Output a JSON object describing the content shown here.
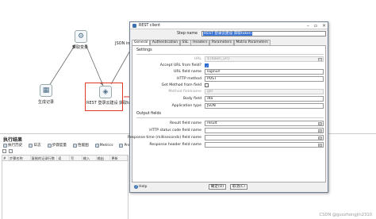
{
  "canvas": {
    "steps": [
      {
        "id": "get-var",
        "label": "获取变量",
        "glyph": "⚙"
      },
      {
        "id": "gen-record",
        "label": "生成记录",
        "glyph": "▦"
      },
      {
        "id": "rest",
        "label": "REST 登录云建设  获取token",
        "glyph": "◈"
      },
      {
        "id": "json-input",
        "label": "JSON inp",
        "glyph": "{}"
      }
    ]
  },
  "exec": {
    "title": "执行结果",
    "tabs": [
      {
        "label": "执行历史",
        "icon": "history-icon"
      },
      {
        "label": "日志",
        "icon": "log-icon"
      },
      {
        "label": "步骤度量",
        "icon": "metrics-icon"
      },
      {
        "label": "性能图",
        "icon": "chart-icon"
      },
      {
        "label": "Metrics",
        "icon": "metrics-icon"
      },
      {
        "label": "Preview data",
        "icon": "preview-icon"
      }
    ],
    "columns": [
      "#",
      "步骤名称",
      "复制的记录行数",
      "读",
      "写",
      "输入",
      "输出",
      "更新"
    ]
  },
  "dialog": {
    "title": "REST client",
    "stepname_label": "Step name",
    "stepname_value": "REST 登录云建设 获取token",
    "tabs": [
      "General",
      "Authentication",
      "SSL",
      "Headers",
      "Parameters",
      "Matrix Parameters"
    ],
    "settings_title": "Settings",
    "fields": [
      {
        "label": "URL",
        "value": "${token_url}",
        "disabled": true
      },
      {
        "label": "Accept URL from field?",
        "type": "check",
        "checked": true
      },
      {
        "label": "URL field name",
        "value": "loginurl",
        "disabled": false
      },
      {
        "label": "HTTP method",
        "value": "POST",
        "disabled": false
      },
      {
        "label": "Get Method from field",
        "type": "check",
        "checked": false
      },
      {
        "label": "Method fieldname",
        "value": "get",
        "disabled": true
      },
      {
        "label": "Body field",
        "value": "dta",
        "disabled": false
      },
      {
        "label": "Application type",
        "value": "JSON",
        "disabled": false
      }
    ],
    "output_title": "Output fields",
    "outputs": [
      {
        "label": "Result field name",
        "value": "result"
      },
      {
        "label": "HTTP status code field name",
        "value": ""
      },
      {
        "label": "Response time (milliseconds) field name",
        "value": ""
      },
      {
        "label": "Response header field name",
        "value": ""
      }
    ],
    "ok_label": "确定(O)",
    "cancel_label": "取消(C)",
    "help_label": "Help"
  },
  "watermark": "CSDN @guozhongjin2310",
  "colors": {
    "highlight": "#e23a24",
    "accent": "#3875d7"
  }
}
